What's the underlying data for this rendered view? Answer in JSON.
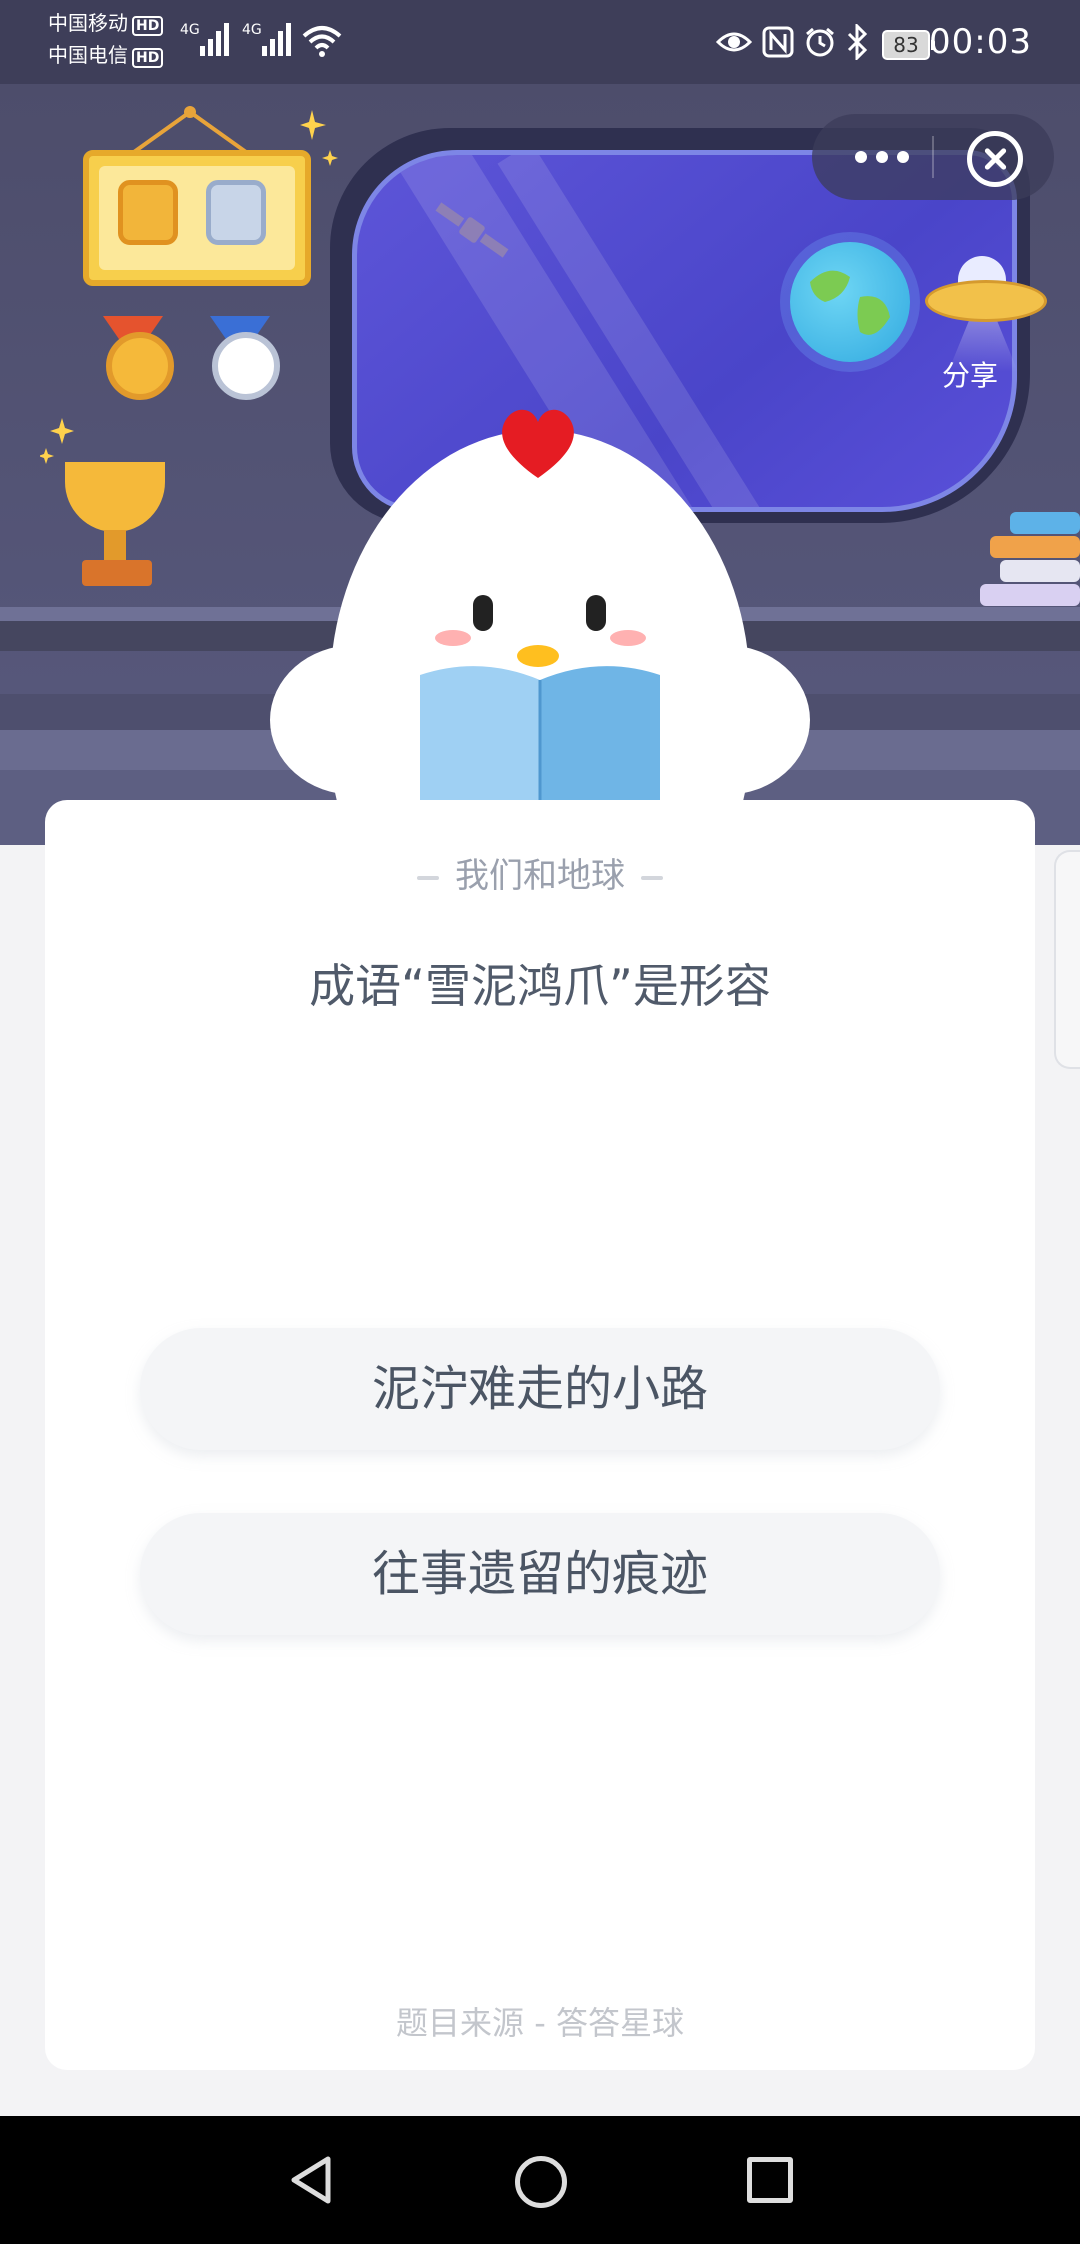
{
  "status_bar": {
    "carrier1": "中国移动",
    "carrier2": "中国电信",
    "hd_label": "HD",
    "network1": "4G",
    "network2": "4G",
    "battery": "83",
    "time": "00:03"
  },
  "mini_program": {
    "share_label": "分享"
  },
  "quiz": {
    "category": "我们和地球",
    "question": "成语“雪泥鸿爪”是形容",
    "options": [
      "泥泞难走的小路",
      "往事遗留的痕迹"
    ],
    "source": "题目来源 - 答答星球"
  },
  "colors": {
    "scene_bg": "#4e4f6e",
    "window_glass": "#4a45c9",
    "comb_red": "#e51c23",
    "page_bg": "#f3f3f5"
  }
}
